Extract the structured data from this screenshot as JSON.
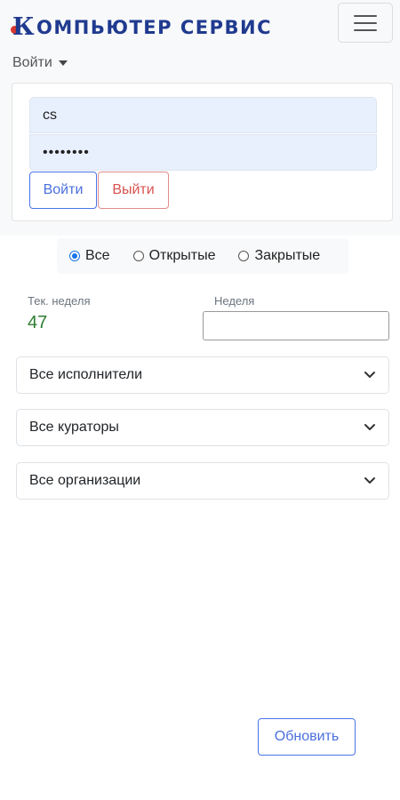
{
  "brand": {
    "logo_letter": "К",
    "name": "ОМПЬЮТЕР СЕРВИС",
    "logo_colors": {
      "primary": "#1f3a8f",
      "accent": "#d9382e"
    }
  },
  "nav": {
    "menu_icon": "hamburger-icon",
    "login_toggle_label": "Войти",
    "login_toggle_icon": "caret-down-icon"
  },
  "login_form": {
    "username_value": "cs",
    "password_value": "••••••••",
    "login_button": "Войти",
    "logout_button": "Выйти"
  },
  "filter": {
    "options": [
      {
        "label": "Все",
        "checked": true
      },
      {
        "label": "Открытые",
        "checked": false
      },
      {
        "label": "Закрытые",
        "checked": false
      }
    ]
  },
  "week": {
    "current_label": "Тек. неделя",
    "current_value": "47",
    "input_label": "Неделя",
    "input_value": ""
  },
  "selects": {
    "executors": "Все исполнители",
    "curators": "Все кураторы",
    "organizations": "Все организации"
  },
  "actions": {
    "refresh_button": "Обновить"
  },
  "colors": {
    "primary_button": "#4a6fdc",
    "danger_button": "#d9534f",
    "current_week_value": "#2e7d32",
    "radio_checked": "#1a73e8"
  }
}
